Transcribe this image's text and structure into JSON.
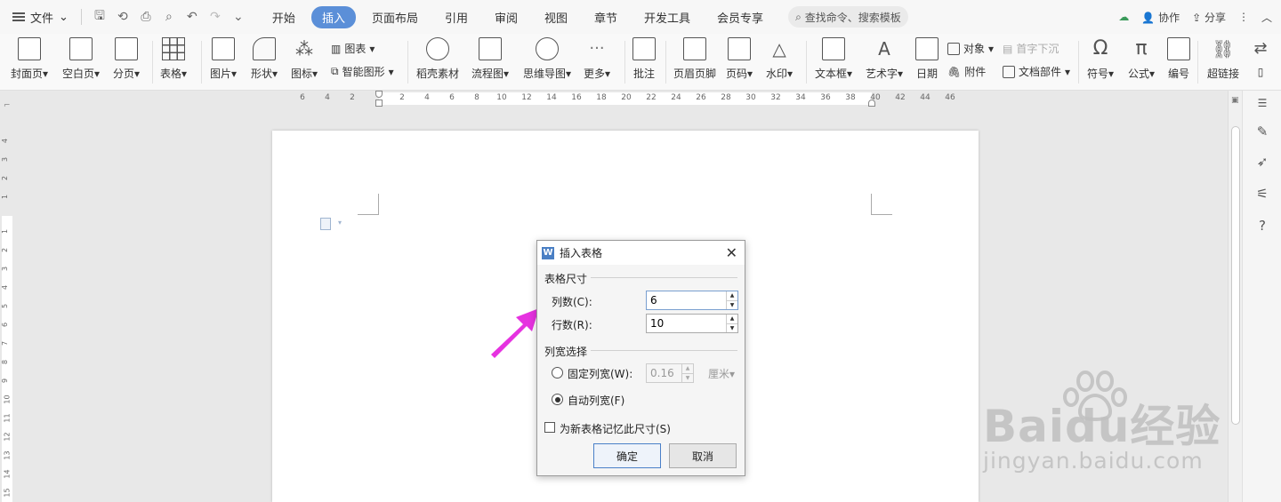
{
  "menubar": {
    "file_label": "文件",
    "tabs": [
      "开始",
      "插入",
      "页面布局",
      "引用",
      "审阅",
      "视图",
      "章节",
      "开发工具",
      "会员专享"
    ],
    "active_tab": "插入",
    "search_placeholder": "查找命令、搜索模板",
    "collab_label": "协作",
    "share_label": "分享"
  },
  "ribbon": {
    "cover": "封面页",
    "blank": "空白页",
    "pagebreak": "分页",
    "table": "表格",
    "picture": "图片",
    "shape": "形状",
    "icon": "图标",
    "chart": "图表",
    "smartart": "智能图形",
    "material": "稻壳素材",
    "flowchart": "流程图",
    "mindmap": "思维导图",
    "more": "更多",
    "comment": "批注",
    "header_footer": "页眉页脚",
    "page_number": "页码",
    "watermark": "水印",
    "textbox": "文本框",
    "wordart": "艺术字",
    "date": "日期",
    "object": "对象",
    "attachment": "附件",
    "dropcap": "首字下沉",
    "docpart": "文档部件",
    "symbol": "符号",
    "formula": "公式",
    "numbering": "编号",
    "hyperlink": "超链接"
  },
  "ruler": {
    "h_ticks": [
      "6",
      "4",
      "2",
      "2",
      "4",
      "6",
      "8",
      "10",
      "12",
      "14",
      "16",
      "18",
      "20",
      "22",
      "24",
      "26",
      "28",
      "30",
      "32",
      "34",
      "36",
      "38",
      "40",
      "42",
      "44",
      "46"
    ],
    "v_ticks_top": [
      "4",
      "3",
      "2",
      "1"
    ],
    "v_ticks": [
      "1",
      "2",
      "3",
      "4",
      "5",
      "6",
      "7",
      "8",
      "9",
      "10",
      "11",
      "12",
      "13",
      "14",
      "15"
    ]
  },
  "dialog": {
    "title": "插入表格",
    "size_group": "表格尺寸",
    "columns_label": "列数(C):",
    "columns_value": "6",
    "rows_label": "行数(R):",
    "rows_value": "10",
    "width_group": "列宽选择",
    "fixed_label": "固定列宽(W):",
    "fixed_value": "0.16",
    "fixed_unit": "厘米",
    "auto_label": "自动列宽(F)",
    "remember_label": "为新表格记忆此尺寸(S)",
    "ok": "确定",
    "cancel": "取消",
    "auto_selected": true,
    "remember_checked": false
  },
  "watermark": {
    "brand": "Baidu经验",
    "url": "jingyan.baidu.com"
  },
  "colors": {
    "accent": "#5b8fd8",
    "arrow": "#e632e0"
  }
}
